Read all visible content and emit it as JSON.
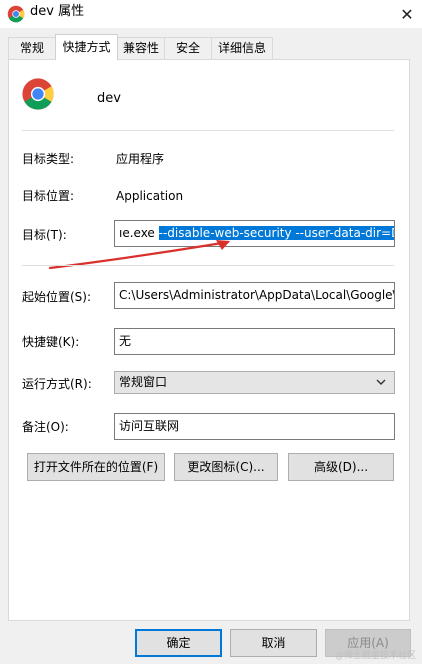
{
  "window": {
    "title": "dev 属性",
    "close_glyph": "✕"
  },
  "tabs": [
    "常规",
    "快捷方式",
    "兼容性",
    "安全",
    "详细信息"
  ],
  "active_tab": "快捷方式",
  "header": {
    "name": "dev"
  },
  "rows": {
    "target_type": {
      "label": "目标类型:",
      "value": "应用程序"
    },
    "target_location": {
      "label": "目标位置:",
      "value": "Application"
    },
    "target": {
      "label": "目标(T):",
      "value_plain": "ıe.exe ",
      "value_selected": "--disable-web-security --user-data-dir=D"
    },
    "start_in": {
      "label": "起始位置(S):",
      "value": "C:\\Users\\Administrator\\AppData\\Local\\Google\\"
    },
    "shortcut_key": {
      "label": "快捷键(K):",
      "value": "无"
    },
    "run": {
      "label": "运行方式(R):",
      "value": "常规窗口"
    },
    "comment": {
      "label": "备注(O):",
      "value": "访问互联网"
    }
  },
  "action_buttons": {
    "open_location": "打开文件所在的位置(F)",
    "change_icon": "更改图标(C)...",
    "advanced": "高级(D)..."
  },
  "footer": {
    "ok": "确定",
    "cancel": "取消",
    "apply": "应用(A)"
  },
  "watermark": "@稀土掘金技术社区",
  "icons": {
    "app_icon": "chrome-icon",
    "dropdown": "chevron-down-icon"
  },
  "colors": {
    "selection": "#0078d7",
    "annotation_arrow": "#d9302c"
  }
}
